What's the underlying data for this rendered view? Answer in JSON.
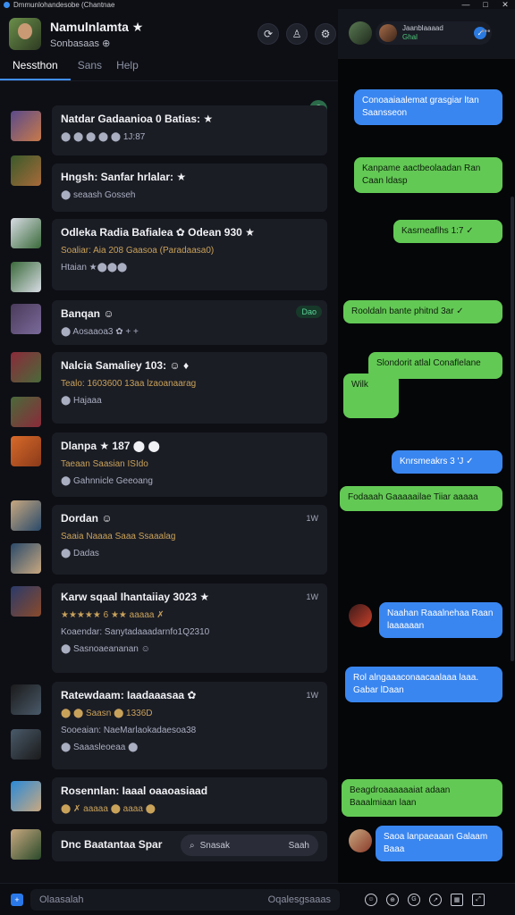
{
  "window": {
    "title": "Dmmunlohandesobe  (Chantnae",
    "minimize": "—",
    "maximize": "□",
    "close": "✕"
  },
  "profile": {
    "name": "Namulnlamta ★",
    "status": "Sonbasaas ⊕"
  },
  "header_icons": [
    "refresh-icon",
    "person-icon",
    "settings-icon"
  ],
  "tabs": [
    {
      "label": "Nessthon",
      "active": true
    },
    {
      "label": "Sans",
      "active": false
    },
    {
      "label": "Help",
      "active": false
    }
  ],
  "unread_badge": "@",
  "rows": [
    {
      "title": "Natdar Gadaanioa 0 Batias: ★",
      "line2": "",
      "line3": "⬤ ⬤ ⬤ ⬤ ⬤  1J:87",
      "time": "",
      "tag": "",
      "thumb_colors": [
        "#5a4a8a",
        "#c87a4a"
      ]
    },
    {
      "title": "Hngsh: Sanfar hrlalar: ★",
      "line2": "",
      "line3": "⬤ seaash Gosseh",
      "time": "",
      "tag": "",
      "thumb_colors": [
        "#3a5a2a",
        "#a86a3a"
      ]
    },
    {
      "title": "Odleka Radia Bafialea ✿ Odean 930 ★",
      "line2": "Soaliar: Aia 208 Gaasoa (Paradaasa0)",
      "line3": "Htaian ★⬤⬤⬤",
      "time": "",
      "tag": "",
      "thumb_colors": [
        "#d8dce4",
        "#3a6a3a"
      ]
    },
    {
      "title": "Banqan ☺",
      "line2": "",
      "line3": "⬤ Aosaaoa3 ✿ + +",
      "time": "",
      "tag": "Dao",
      "thumb_colors": [
        "#4a3a5a",
        "#7a6a9a"
      ]
    },
    {
      "title": "Nalcia Samaliey 103: ☺ ♦",
      "line2": "Tealo: 1603600 13aa lzaoanaarag",
      "line3": "⬤ Hajaaa",
      "time": "",
      "tag": "",
      "thumb_colors": [
        "#8a2a3a",
        "#4a6a3a"
      ]
    },
    {
      "title": "Dlanpa ★        187 ⬤ ⬤",
      "line2": "Taeaan   Saasian   ISIdo",
      "line3": "⬤ Gahnnicle Geeoang",
      "time": "",
      "tag": "",
      "thumb_colors": [
        "#d86a2a",
        "#8a3a1a"
      ]
    },
    {
      "title": "Dordan ☺",
      "line2": "Saaia Naaaa Saaa Ssaaalag",
      "line3": "⬤ Dadas",
      "time": "1W",
      "tag": "",
      "thumb_colors": [
        "#c8a880",
        "#2a4a6a"
      ]
    },
    {
      "title": "Karw sqaal Ihantaiiay 3023 ★",
      "line2": "★★★★★ 6 ★★ aaaaa ✗",
      "line3": "Koaendar: Sanytadaaadarnfo1Q2310",
      "line4": "⬤ Sasnoaeananan ☺",
      "time": "1W",
      "tag": "",
      "thumb_colors": [
        "#2a3a6a",
        "#8a4a2a"
      ]
    },
    {
      "title": "Ratewdaam: Iaadaaasaa ✿",
      "line2": "⬤ ⬤ Saasn ⬤ 1336D",
      "line3": "Sooeaian: NaeMarlaokadaesoa38",
      "line4": "⬤ Saaasleoeaa ⬤",
      "time": "1W",
      "tag": "",
      "thumb_colors": [
        "#1a1a1a",
        "#4a5a6a"
      ]
    },
    {
      "title": "Rosennlan: Iaaal oaaoasiaad",
      "line2": "⬤ ✗ aaaaa ⬤ aaaa ⬤",
      "line3": "",
      "time": "",
      "tag": "",
      "thumb_colors": [
        "#2a8ad8",
        "#c8a880"
      ]
    },
    {
      "title": "Dnc Baatantaa Spar",
      "line2": "",
      "line3": "",
      "time": "",
      "tag": "",
      "thumb_colors": [
        "#c8a880",
        "#2a4a2a"
      ]
    }
  ],
  "search": {
    "placeholder": "Snasak",
    "button": "Saah"
  },
  "chat_header": {
    "name": "Jaanblaaaad",
    "sub": "Ghal",
    "more": "•••"
  },
  "messages": [
    {
      "text": "Conoaaiaalemat grasgiar ltan Saansseon",
      "side": "blue"
    },
    {
      "text": "Kanpame aactbeolaadan Ran Caan ldasp",
      "side": "green"
    },
    {
      "text": "Kasrneaflhs  1:7 ✓",
      "side": "green"
    },
    {
      "text": "Rooldaln bante phitnd 3ar ✓",
      "side": "green"
    },
    {
      "text": "Slondorit atlal Conaflelane",
      "side": "green"
    },
    {
      "text": "Wilk",
      "side": "green"
    },
    {
      "text": "Knrsmeakrs 3 'J ✓",
      "side": "blue"
    },
    {
      "text": "Fodaaah Gaaaaailae Tiiar aaaaa",
      "side": "green"
    },
    {
      "text": "Naahan Raaalnehaa Raan laaaaaan",
      "side": "blue"
    },
    {
      "text": "Rol alngaaaconaacaalaaa laaa. Gabar lDaan",
      "side": "blue"
    },
    {
      "text": "Beagdroaaaaaaiat adaan Baaalmiaan laan",
      "side": "green"
    },
    {
      "text": "Saoa lanpaeaaan Galaam Baaa",
      "side": "blue"
    }
  ],
  "composer": {
    "placeholder": "Olaasalah",
    "hint": "Oqalesgsaaas"
  },
  "composer_icons": [
    "emoji-icon",
    "attach-icon",
    "gif-icon",
    "share-icon",
    "image-icon",
    "expand-icon"
  ]
}
